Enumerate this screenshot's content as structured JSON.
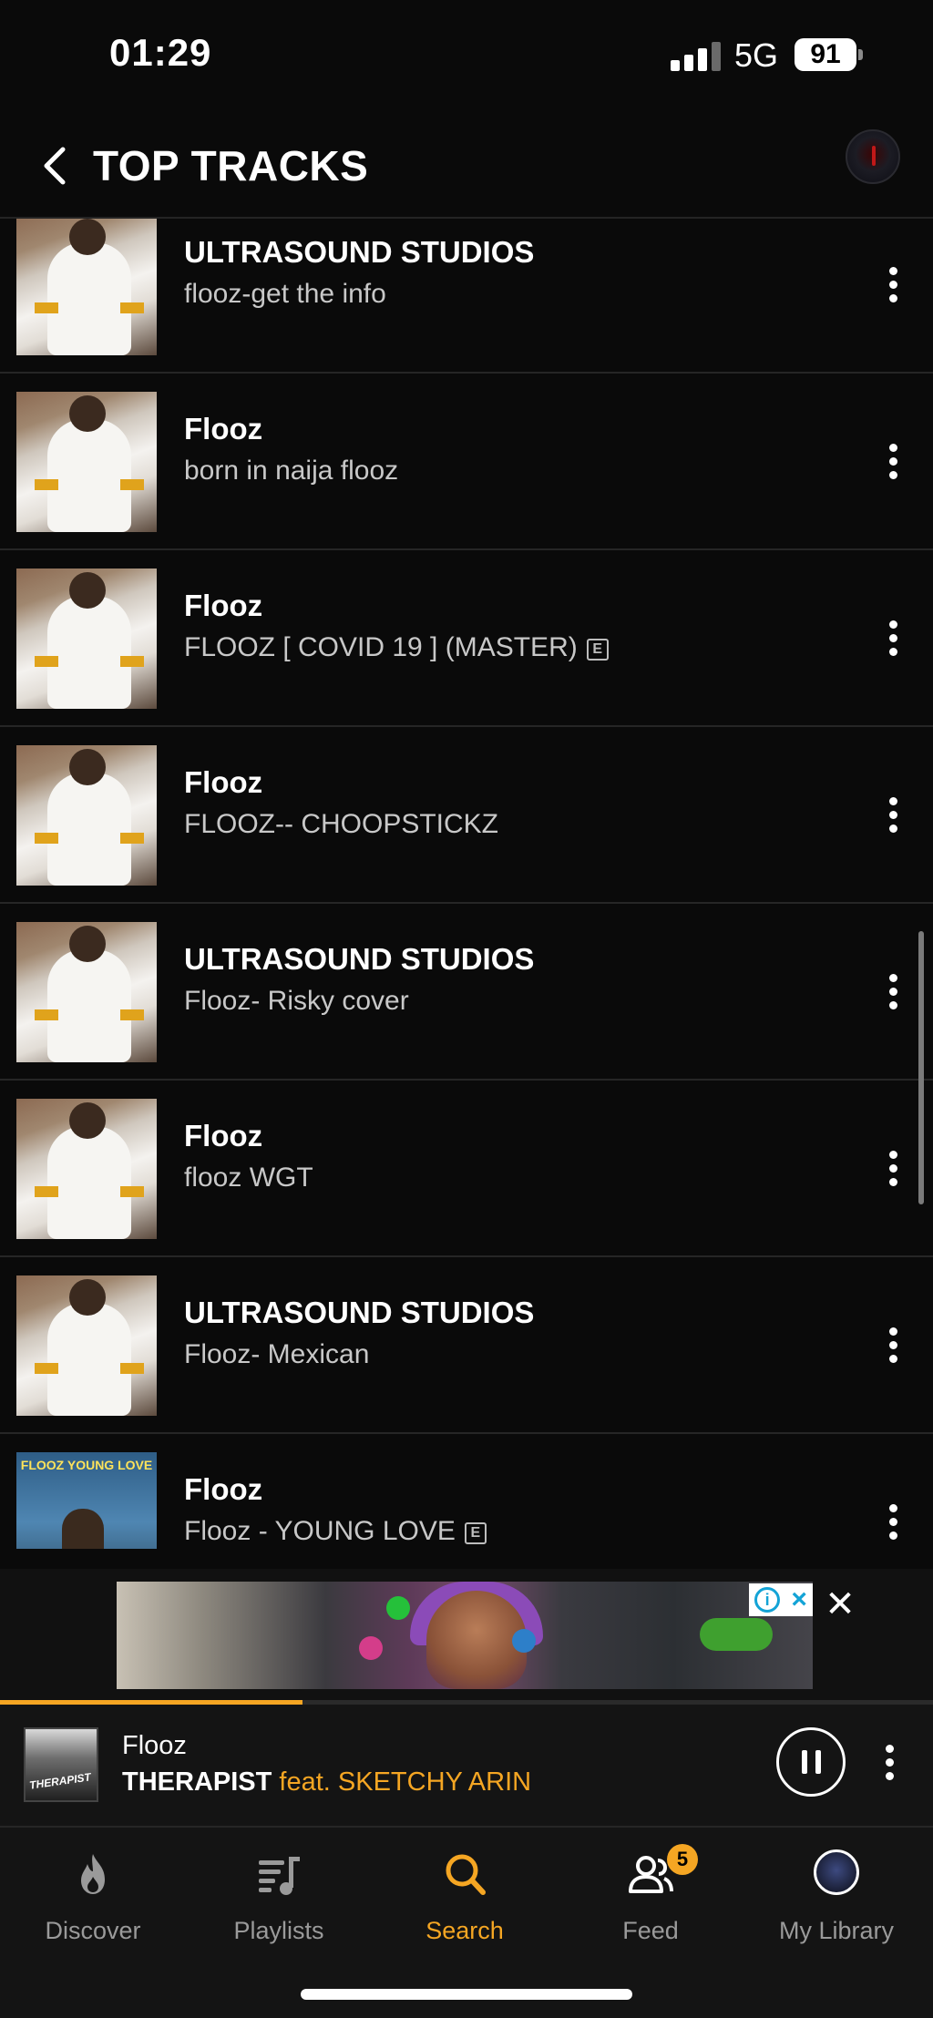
{
  "status_bar": {
    "time": "01:29",
    "network": "5G",
    "battery": "91"
  },
  "header": {
    "title": "TOP TRACKS"
  },
  "tracks": [
    {
      "artist": "ULTRASOUND STUDIOS",
      "title": "flooz-get the info",
      "explicit": false
    },
    {
      "artist": "Flooz",
      "title": "born in naija flooz",
      "explicit": false
    },
    {
      "artist": "Flooz",
      "title": "FLOOZ [ COVID 19  ]  (MASTER)",
      "explicit": true
    },
    {
      "artist": "Flooz",
      "title": "FLOOZ-- CHOOPSTICKZ",
      "explicit": false
    },
    {
      "artist": "ULTRASOUND STUDIOS",
      "title": "Flooz- Risky cover",
      "explicit": false
    },
    {
      "artist": "Flooz",
      "title": "flooz WGT",
      "explicit": false
    },
    {
      "artist": "ULTRASOUND STUDIOS",
      "title": "Flooz- Mexican",
      "explicit": false
    },
    {
      "artist": "Flooz",
      "title": "Flooz - YOUNG LOVE",
      "explicit": true,
      "cover_text": "FLOOZ YOUNG LOVE"
    }
  ],
  "explicit_badge": "E",
  "ad": {
    "close_label": "✕"
  },
  "player": {
    "artist": "Flooz",
    "track": "THERAPIST",
    "featuring": "feat. SKETCHY ARIN",
    "progress": 0.32
  },
  "tabs": [
    {
      "label": "Discover",
      "icon": "flame-icon",
      "active": false
    },
    {
      "label": "Playlists",
      "icon": "playlist-icon",
      "active": false
    },
    {
      "label": "Search",
      "icon": "search-icon",
      "active": true
    },
    {
      "label": "Feed",
      "icon": "people-icon",
      "active": false,
      "badge": "5"
    },
    {
      "label": "My Library",
      "icon": "library-avatar-icon",
      "active": false
    }
  ],
  "colors": {
    "accent": "#f5a623",
    "background": "#0a0a0a"
  }
}
